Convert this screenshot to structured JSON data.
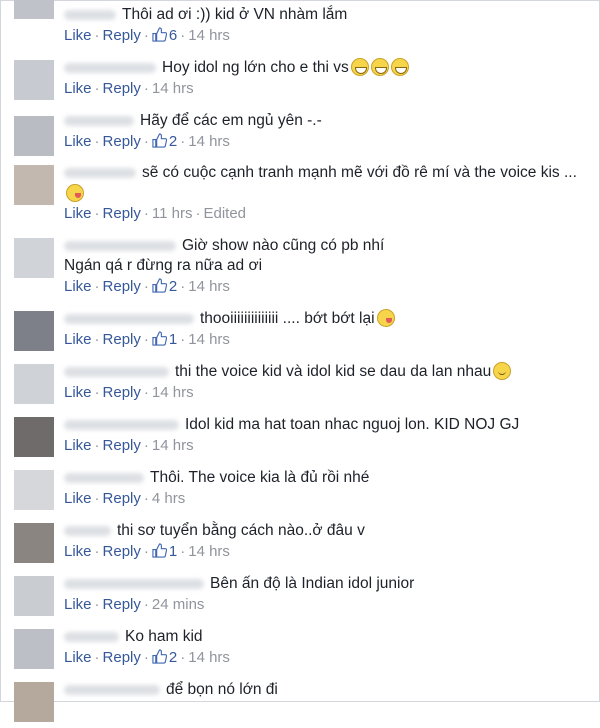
{
  "actions": {
    "like_label": "Like",
    "reply_label": "Reply",
    "separator": "·"
  },
  "comments": [
    {
      "text": "Thôi ad ơi :)) kid ở VN nhàm lắm",
      "likes": "6",
      "time": "14 hrs"
    },
    {
      "text": "Hoy idol ng lớn cho e thi vs",
      "emoji": [
        "grin",
        "grin",
        "grin"
      ],
      "likes": "",
      "time": "14 hrs"
    },
    {
      "text": "Hãy để các em ngủ yên -.-",
      "likes": "2",
      "time": "14 hrs"
    },
    {
      "text": "sẽ có cuộc cạnh tranh mạnh mẽ với đồ rê mí và the voice kis ...",
      "continuation_emoji": "tongue",
      "likes": "",
      "time": "11 hrs",
      "edited": "Edited"
    },
    {
      "text": "Giờ show nào cũng có pb nhí",
      "continuation": "Ngán qá r đừng ra nữa ad ơi",
      "likes": "2",
      "time": "14 hrs"
    },
    {
      "text": "thooiiiiiiiiiiiiii .... bớt bớt lại",
      "emoji": [
        "tongue"
      ],
      "likes": "1",
      "time": "14 hrs"
    },
    {
      "text": "thi the voice kid và idol kid se dau da lan nhau",
      "emoji": [
        "smile"
      ],
      "likes": "",
      "time": "14 hrs"
    },
    {
      "text": "Idol kid ma hat toan nhac nguoj lon. KID NOJ GJ",
      "likes": "",
      "time": "14 hrs"
    },
    {
      "text": "Thôi. The voice kia là đủ rồi nhé",
      "likes": "",
      "time": "4 hrs"
    },
    {
      "text": "thi sơ tuyển bằng cách nào..ở đâu v",
      "likes": "1",
      "time": "14 hrs"
    },
    {
      "text": "Bên ấn độ là Indian idol junior",
      "likes": "",
      "time": "24 mins"
    },
    {
      "text": "Ko ham kid",
      "likes": "2",
      "time": "14 hrs"
    },
    {
      "text": "để bọn nó lớn đi"
    }
  ]
}
